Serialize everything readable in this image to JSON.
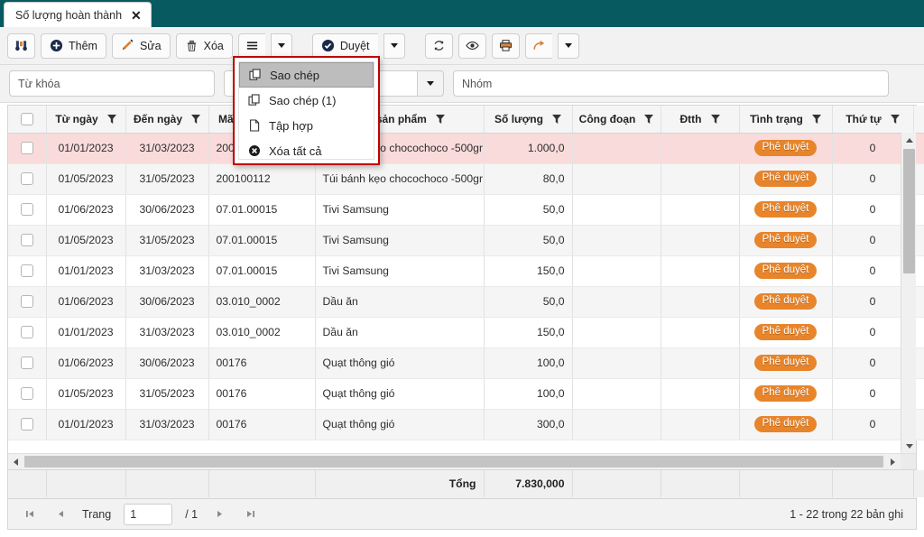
{
  "window": {
    "tab_title": "Số lượng hoàn thành",
    "tab_close": "✕",
    "accent_teal": "#085a61",
    "menu_border": "#c00000",
    "badge_color": "#e8842a",
    "selected_row_color": "#fadbdb"
  },
  "toolbar": {
    "search_icon": "binoculars-icon",
    "add_label": "Thêm",
    "edit_label": "Sửa",
    "delete_label": "Xóa",
    "hamburger_icon": "hamburger-icon",
    "hamburger_caret": "chevron-down-icon",
    "approve_label": "Duyệt",
    "approve_caret": "chevron-down-icon",
    "refresh_icon": "refresh-icon",
    "preview_icon": "eye-icon",
    "print_icon": "printer-icon",
    "export_icon": "arrow-forward-icon",
    "export_caret": "chevron-down-icon"
  },
  "dropdown_menu": {
    "open": true,
    "items": [
      {
        "label": "Sao chép",
        "icon": "copy-icon",
        "active": true
      },
      {
        "label": "Sao chép (1)",
        "icon": "copy-icon",
        "active": false
      },
      {
        "label": "Tập hợp",
        "icon": "file-icon",
        "active": false
      },
      {
        "label": "Xóa tất cả",
        "icon": "delete-circle-icon",
        "active": false
      }
    ]
  },
  "filters": {
    "keyword_placeholder": "Từ khóa",
    "keyword_value": "",
    "combo_value": "",
    "combo_caret": "chevron-down-icon",
    "group_placeholder": "Nhóm",
    "group_value": ""
  },
  "grid": {
    "columns": [
      {
        "key": "check",
        "label": ""
      },
      {
        "key": "tu_ngay",
        "label": "Từ ngày"
      },
      {
        "key": "den_ngay",
        "label": "Đến ngày"
      },
      {
        "key": "ma_sp",
        "label": "Mã sản phẩm"
      },
      {
        "key": "ten_sp",
        "label": "Tên sản phẩm"
      },
      {
        "key": "so_luong",
        "label": "Số lượng"
      },
      {
        "key": "cong_doan",
        "label": "Công đoạn"
      },
      {
        "key": "dtth",
        "label": "Đtth"
      },
      {
        "key": "tinh_trang",
        "label": "Tình trạng"
      },
      {
        "key": "thu_tu",
        "label": "Thứ tự"
      }
    ],
    "rows": [
      {
        "tu_ngay": "01/01/2023",
        "den_ngay": "31/03/2023",
        "ma_sp": "200100112",
        "ten_sp": "Túi bánh kẹo chocochoco -500gr",
        "so_luong": "1.000,0",
        "cong_doan": "",
        "dtth": "",
        "tinh_trang": "Phê duyệt",
        "thu_tu": "0",
        "selected": true
      },
      {
        "tu_ngay": "01/05/2023",
        "den_ngay": "31/05/2023",
        "ma_sp": "200100112",
        "ten_sp": "Túi bánh kẹo chocochoco -500gr",
        "so_luong": "80,0",
        "cong_doan": "",
        "dtth": "",
        "tinh_trang": "Phê duyệt",
        "thu_tu": "0",
        "selected": false
      },
      {
        "tu_ngay": "01/06/2023",
        "den_ngay": "30/06/2023",
        "ma_sp": "07.01.00015",
        "ten_sp": "Tivi Samsung",
        "so_luong": "50,0",
        "cong_doan": "",
        "dtth": "",
        "tinh_trang": "Phê duyệt",
        "thu_tu": "0",
        "selected": false
      },
      {
        "tu_ngay": "01/05/2023",
        "den_ngay": "31/05/2023",
        "ma_sp": "07.01.00015",
        "ten_sp": "Tivi Samsung",
        "so_luong": "50,0",
        "cong_doan": "",
        "dtth": "",
        "tinh_trang": "Phê duyệt",
        "thu_tu": "0",
        "selected": false
      },
      {
        "tu_ngay": "01/01/2023",
        "den_ngay": "31/03/2023",
        "ma_sp": "07.01.00015",
        "ten_sp": "Tivi Samsung",
        "so_luong": "150,0",
        "cong_doan": "",
        "dtth": "",
        "tinh_trang": "Phê duyệt",
        "thu_tu": "0",
        "selected": false
      },
      {
        "tu_ngay": "01/06/2023",
        "den_ngay": "30/06/2023",
        "ma_sp": "03.010_0002",
        "ten_sp": "Dầu ăn",
        "so_luong": "50,0",
        "cong_doan": "",
        "dtth": "",
        "tinh_trang": "Phê duyệt",
        "thu_tu": "0",
        "selected": false
      },
      {
        "tu_ngay": "01/01/2023",
        "den_ngay": "31/03/2023",
        "ma_sp": "03.010_0002",
        "ten_sp": "Dầu ăn",
        "so_luong": "150,0",
        "cong_doan": "",
        "dtth": "",
        "tinh_trang": "Phê duyệt",
        "thu_tu": "0",
        "selected": false
      },
      {
        "tu_ngay": "01/06/2023",
        "den_ngay": "30/06/2023",
        "ma_sp": "00176",
        "ten_sp": "Quạt thông gió",
        "so_luong": "100,0",
        "cong_doan": "",
        "dtth": "",
        "tinh_trang": "Phê duyệt",
        "thu_tu": "0",
        "selected": false
      },
      {
        "tu_ngay": "01/05/2023",
        "den_ngay": "31/05/2023",
        "ma_sp": "00176",
        "ten_sp": "Quạt thông gió",
        "so_luong": "100,0",
        "cong_doan": "",
        "dtth": "",
        "tinh_trang": "Phê duyệt",
        "thu_tu": "0",
        "selected": false
      },
      {
        "tu_ngay": "01/01/2023",
        "den_ngay": "31/03/2023",
        "ma_sp": "00176",
        "ten_sp": "Quạt thông gió",
        "so_luong": "300,0",
        "cong_doan": "",
        "dtth": "",
        "tinh_trang": "Phê duyệt",
        "thu_tu": "0",
        "selected": false
      }
    ]
  },
  "summary": {
    "label": "Tổng",
    "value": "7.830,000"
  },
  "pager": {
    "first_icon": "first-page-icon",
    "prev_icon": "prev-page-icon",
    "page_label": "Trang",
    "page_value": "1",
    "total_pages": "/ 1",
    "next_icon": "next-page-icon",
    "last_icon": "last-page-icon",
    "record_info": "1 - 22 trong 22 bản ghi"
  }
}
